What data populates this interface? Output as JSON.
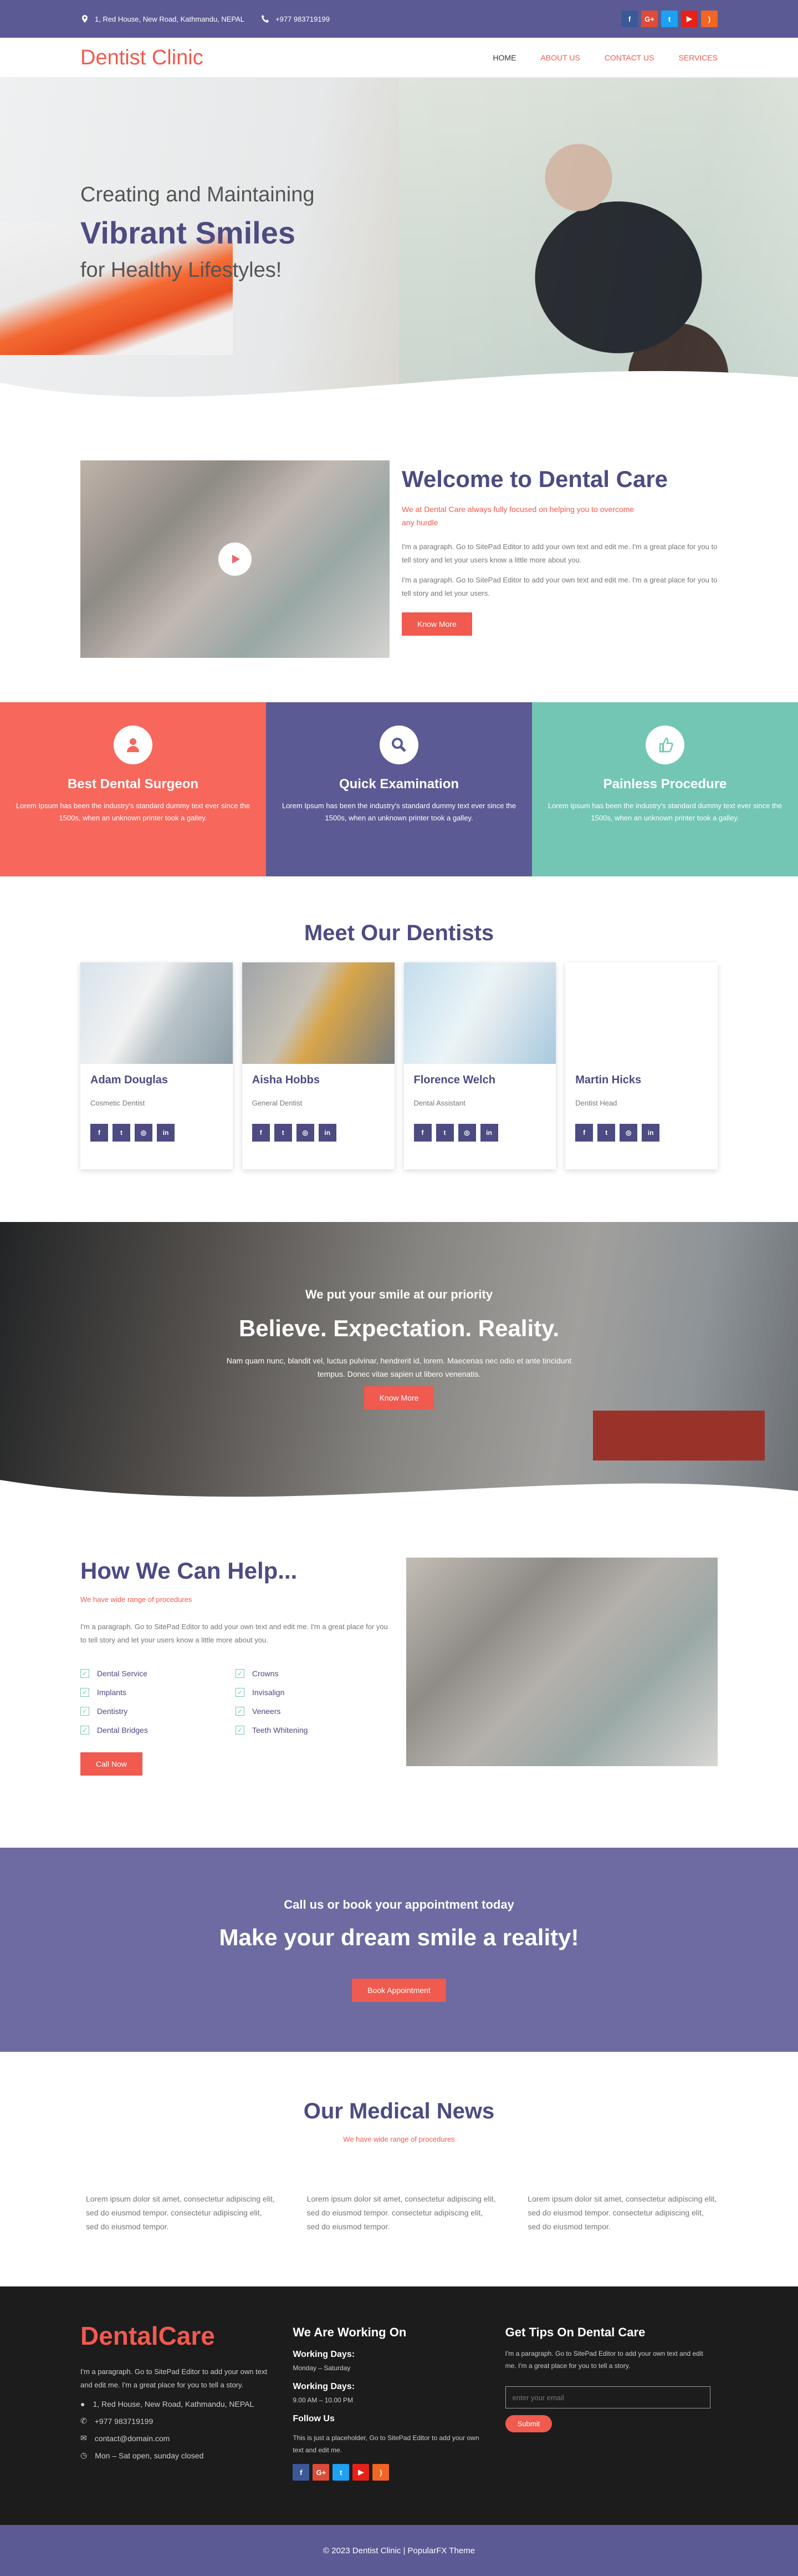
{
  "topbar": {
    "address": "1, Red House, New Road, Kathmandu, NEPAL",
    "phone": "+977 983719199",
    "social": [
      {
        "icon": "facebook-icon",
        "glyph": "f",
        "color": "#3b5998"
      },
      {
        "icon": "google-plus-icon",
        "glyph": "G+",
        "color": "#dd4b39"
      },
      {
        "icon": "twitter-icon",
        "glyph": "t",
        "color": "#1da1f2"
      },
      {
        "icon": "youtube-icon",
        "glyph": "▶",
        "color": "#e62117"
      },
      {
        "icon": "rss-icon",
        "glyph": ")",
        "color": "#f26522"
      }
    ]
  },
  "header": {
    "logo": "Dentist Clinic",
    "nav": [
      "HOME",
      "ABOUT US",
      "CONTACT US",
      "SERVICES"
    ]
  },
  "hero": {
    "line1": "Creating and Maintaining",
    "line2": "Vibrant Smiles",
    "line3": "for Healthy Lifestyles!"
  },
  "welcome": {
    "title": "Welcome to Dental Care",
    "subtitle": "We at Dental Care always fully focused on helping you to overcome any hurdle",
    "para1": "I'm a paragraph. Go to SitePad Editor to add your own text and edit me. I'm a great place for you to tell story and let your users know a little more about you.",
    "para2": "I'm a paragraph. Go to SitePad Editor to add your own text and edit me. I'm a great place for you to tell story and let your users.",
    "button": "Know More"
  },
  "features": [
    {
      "title": "Best Dental Surgeon",
      "text": "Lorem Ipsum has been the industry's standard dummy text ever since the 1500s, when an unknown printer took a galley.",
      "icon": "surgeon-icon"
    },
    {
      "title": "Quick Examination",
      "text": "Lorem Ipsum has been the industry's standard dummy text ever since the 1500s, when an unknown printer took a galley.",
      "icon": "search-icon"
    },
    {
      "title": "Painless Procedure",
      "text": "Lorem Ipsum has been the industry's standard dummy text ever since the 1500s, when an unknown printer took a galley.",
      "icon": "thumbs-up-icon"
    }
  ],
  "dentists": {
    "title": "Meet Our Dentists",
    "members": [
      {
        "name": "Adam Douglas",
        "role": "Cosmetic Dentist"
      },
      {
        "name": "Aisha Hobbs",
        "role": "General Dentist"
      },
      {
        "name": "Florence Welch",
        "role": "Dental Assistant"
      },
      {
        "name": "Martin Hicks",
        "role": "Dentist Head"
      }
    ],
    "social_glyphs": [
      "f",
      "t",
      "◎",
      "in"
    ]
  },
  "promo": {
    "small": "We put your smile at our priority",
    "big": "Believe. Expectation. Reality.",
    "text": "Nam quam nunc, blandit vel, luctus pulvinar, hendrerit id, lorem. Maecenas nec odio et ante tincidunt tempus. Donec vitae sapien ut libero venenatis.",
    "button": "Know More"
  },
  "help": {
    "title": "How We Can Help...",
    "subtitle": "We have wide range of procedures",
    "para": "I'm a paragraph. Go to SitePad Editor to add your own text and edit me. I'm a great place for you to tell story and let your users know a little more about you.",
    "services": [
      "Dental Service",
      "Crowns",
      "Implants",
      "Invisalign",
      "Dentistry",
      "Veneers",
      "Dental Bridges",
      "Teeth Whitening"
    ],
    "button": "Call Now"
  },
  "cta": {
    "small": "Call us or book your appointment today",
    "big": "Make your dream smile a reality!",
    "button": "Book Appointment"
  },
  "news": {
    "title": "Our Medical News",
    "subtitle": "We have wide range of procedures",
    "items": [
      "Lorem ipsum dolor sit amet, consectetur adipiscing elit, sed do eiusmod tempor. consectetur adipiscing elit, sed do eiusmod tempor.",
      "Lorem ipsum dolor sit amet, consectetur adipiscing elit, sed do eiusmod tempor. consectetur adipiscing elit, sed do eiusmod tempor.",
      "Lorem ipsum dolor sit amet, consectetur adipiscing elit, sed do eiusmod tempor. consectetur adipiscing elit, sed do eiusmod tempor."
    ]
  },
  "footer": {
    "logo": "DentalCare",
    "para": "I'm a paragraph. Go to SitePad Editor to add your own text and edit me. I'm a great place for you to tell a story.",
    "address": "1, Red House, New Road, Kathmandu, NEPAL",
    "phone": "+977 983719199",
    "email": "contact@domain.com",
    "hours": "Mon – Sat open, sunday closed",
    "working_title": "We Are Working On",
    "wd1_label": "Working Days:",
    "wd1_value": "Monday – Saturday",
    "wd2_label": "Working Days:",
    "wd2_value": "9.00 AM – 10.00 PM",
    "follow_title": "Follow Us",
    "follow_text": "This is just a placeholder, Go to SitePad Editor to add your own text and edit me.",
    "tips_title": "Get Tips On Dental Care",
    "tips_text": "I'm a paragraph. Go to SitePad Editor to add your own text and edit me. I'm a great place for you to tell a story.",
    "email_placeholder": "enter your email",
    "submit": "Submit",
    "copyright": "© 2023 Dentist Clinic | PopularFX Theme"
  }
}
